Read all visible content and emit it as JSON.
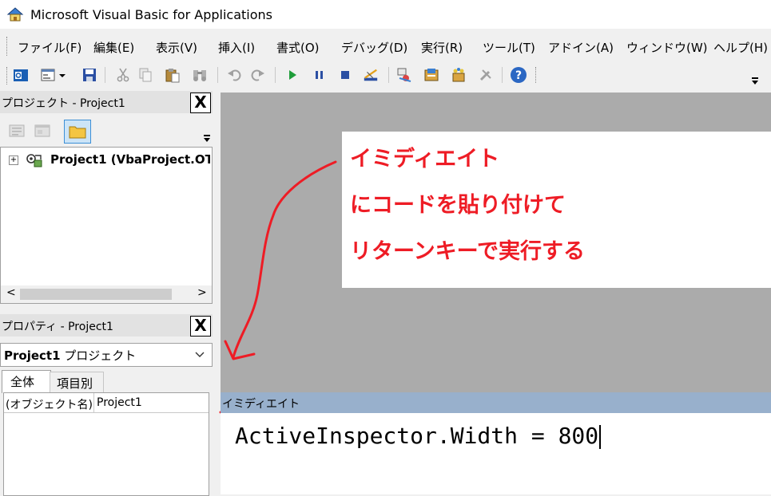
{
  "window": {
    "title": "Microsoft Visual Basic for Applications"
  },
  "menu": {
    "items": [
      "ファイル(F)",
      "編集(E)",
      "表示(V)",
      "挿入(I)",
      "書式(O)",
      "デバッグ(D)",
      "実行(R)",
      "ツール(T)",
      "アドイン(A)",
      "ウィンドウ(W)",
      "ヘルプ(H)"
    ]
  },
  "project_pane": {
    "title": "プロジェクト - Project1",
    "close_label": "X",
    "tree_item": "Project1 (VbaProject.OT"
  },
  "properties_pane": {
    "title": "プロパティ - Project1",
    "close_label": "X",
    "combo_bold": "Project1",
    "combo_rest": " プロジェクト",
    "tabs": [
      "全体",
      "項目別"
    ],
    "grid_name": "(オブジェクト名)",
    "grid_value": "Project1"
  },
  "annotation": {
    "lines": [
      "イミディエイト",
      "にコードを貼り付けて",
      "リターンキーで実行する"
    ],
    "color": "#ee1c25"
  },
  "immediate": {
    "title": "イミディエイト",
    "code": "ActiveInspector.Width = 800"
  },
  "colors": {
    "immediate_title_bg": "#98b0cc",
    "mdi_bg": "#ababab"
  }
}
